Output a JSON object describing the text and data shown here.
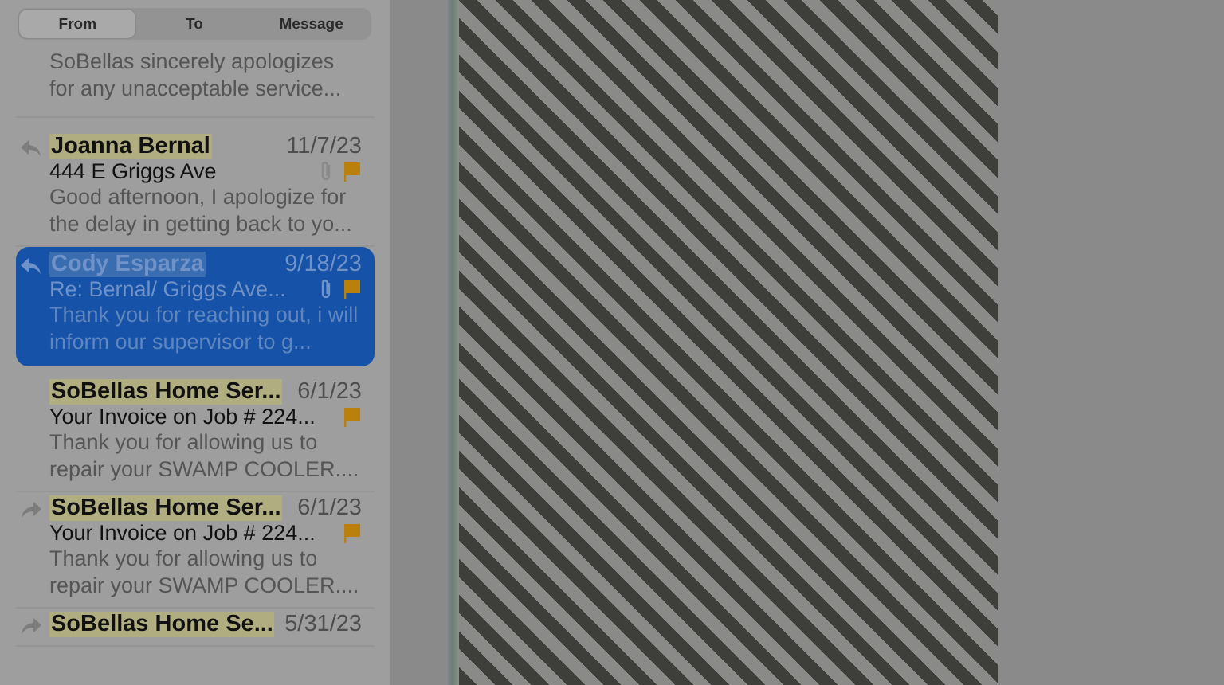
{
  "search_scope_tabs": [
    {
      "label": "From",
      "selected": true
    },
    {
      "label": "To",
      "selected": false
    },
    {
      "label": "Message",
      "selected": false
    }
  ],
  "partial_message": {
    "preview": "SoBellas sincerely apologizes for any unacceptable service..."
  },
  "messages": [
    {
      "sender": "Joanna Bernal",
      "date": "11/7/23",
      "subject": "444 E Griggs Ave",
      "preview": "Good afternoon, I apologize for the delay in getting back to yo...",
      "replied": true,
      "forwarded": false,
      "attachment": true,
      "flagged": true,
      "selected": false
    },
    {
      "sender": "Cody Esparza",
      "date": "9/18/23",
      "subject": "Re: Bernal/ Griggs Ave...",
      "preview": "Thank you for reaching out, i will inform our supervisor to g...",
      "replied": true,
      "forwarded": false,
      "attachment": true,
      "flagged": true,
      "selected": true
    },
    {
      "sender": "SoBellas Home Ser...",
      "date": "6/1/23",
      "subject": "Your Invoice on Job # 224...",
      "preview": "Thank you for allowing us to repair your SWAMP COOLER....",
      "replied": false,
      "forwarded": false,
      "attachment": false,
      "flagged": true,
      "selected": false
    },
    {
      "sender": "SoBellas Home Ser...",
      "date": "6/1/23",
      "subject": "Your Invoice on Job # 224...",
      "preview": "Thank you for allowing us to repair your SWAMP COOLER....",
      "replied": false,
      "forwarded": true,
      "attachment": false,
      "flagged": true,
      "selected": false
    },
    {
      "sender": "SoBellas Home Se...",
      "date": "5/31/23",
      "replied": false,
      "forwarded": true,
      "selected": false
    }
  ]
}
